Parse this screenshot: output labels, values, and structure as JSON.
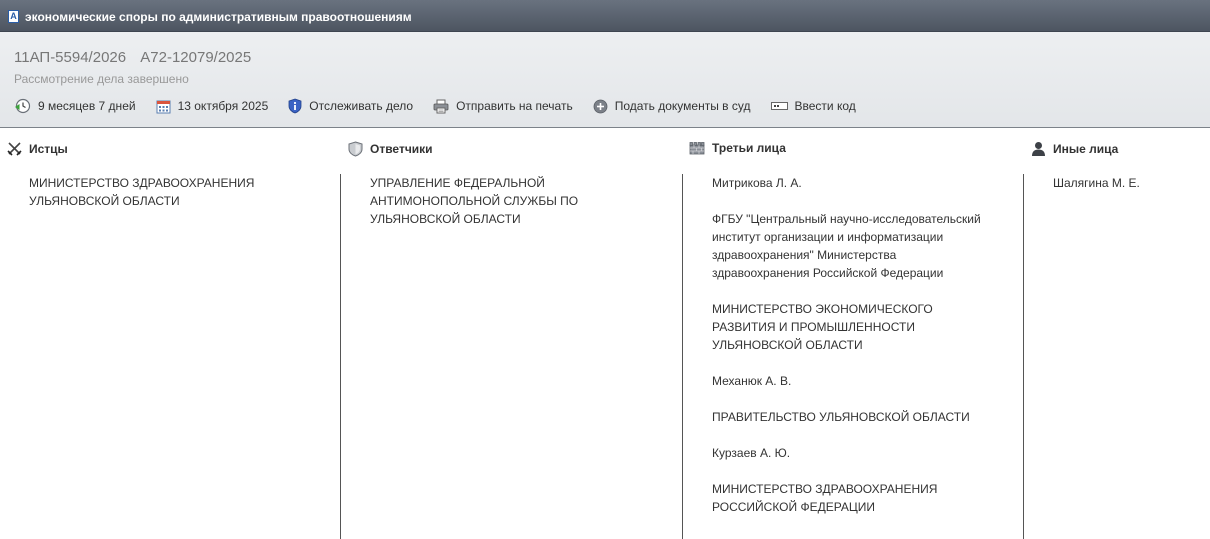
{
  "window": {
    "title": "экономические споры по административным правоотношениям"
  },
  "case": {
    "numbers": [
      "11АП-5594/2026",
      "А72-12079/2025"
    ],
    "status": "Рассмотрение дела завершено"
  },
  "toolbar": {
    "duration": "9 месяцев 7 дней",
    "date": "13 октября 2025",
    "track": "Отслеживать дело",
    "print": "Отправить на печать",
    "submit": "Подать документы в суд",
    "code": "Ввести код"
  },
  "icons": {
    "duration": "clock-back-icon",
    "date": "calendar-icon",
    "track": "shield-info-icon",
    "print": "printer-icon",
    "submit": "plus-circle-icon",
    "code": "key-field-icon",
    "plaintiffs": "crossed-swords-icon",
    "defendants": "shield-icon",
    "third": "castle-wall-icon",
    "other": "person-icon"
  },
  "parties": {
    "plaintiffs": {
      "label": "Истцы",
      "items": [
        "МИНИСТЕРСТВО ЗДРАВООХРАНЕНИЯ УЛЬЯНОВСКОЙ ОБЛАСТИ"
      ]
    },
    "defendants": {
      "label": "Ответчики",
      "items": [
        "УПРАВЛЕНИЕ ФЕДЕРАЛЬНОЙ АНТИМОНОПОЛЬНОЙ СЛУЖБЫ ПО УЛЬЯНОВСКОЙ ОБЛАСТИ"
      ]
    },
    "third": {
      "label": "Третьи лица",
      "items": [
        "Митрикова Л. А.",
        "ФГБУ \"Центральный научно-исследовательский институт организации и информатизации здравоохранения\" Министерства здравоохранения Российской Федерации",
        "МИНИСТЕРСТВО ЭКОНОМИЧЕСКОГО РАЗВИТИЯ И ПРОМЫШЛЕННОСТИ УЛЬЯНОВСКОЙ ОБЛАСТИ",
        "Механюк А. В.",
        "ПРАВИТЕЛЬСТВО УЛЬЯНОВСКОЙ ОБЛАСТИ",
        "Курзаев А. Ю.",
        "МИНИСТЕРСТВО ЗДРАВООХРАНЕНИЯ РОССИЙСКОЙ ФЕДЕРАЦИИ"
      ]
    },
    "other": {
      "label": "Иные лица",
      "items": [
        "Шалягина М. Е."
      ]
    }
  }
}
